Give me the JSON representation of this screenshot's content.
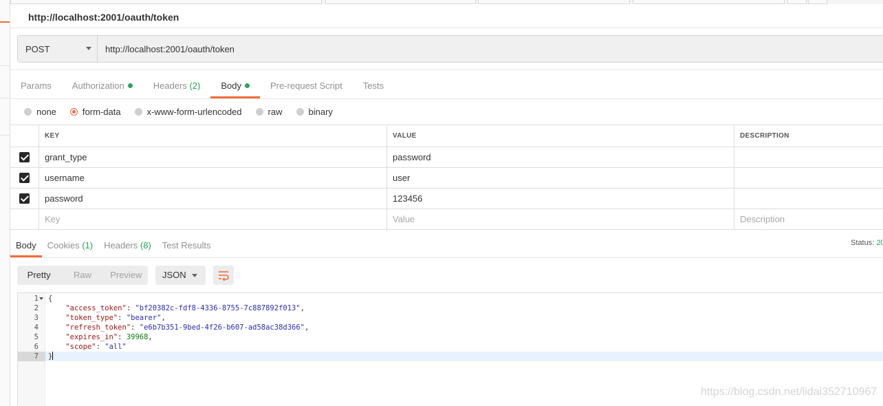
{
  "request": {
    "title": "http://localhost:2001/oauth/token",
    "method": "POST",
    "url": "http://localhost:2001/oauth/token"
  },
  "request_tabs": [
    {
      "label": "Params"
    },
    {
      "label": "Authorization",
      "dot": true
    },
    {
      "label": "Headers",
      "count": "(2)"
    },
    {
      "label": "Body",
      "dot": true,
      "active": true
    },
    {
      "label": "Pre-request Script"
    },
    {
      "label": "Tests"
    }
  ],
  "body_types": [
    {
      "label": "none",
      "selected": false
    },
    {
      "label": "form-data",
      "selected": true
    },
    {
      "label": "x-www-form-urlencoded",
      "selected": false
    },
    {
      "label": "raw",
      "selected": false
    },
    {
      "label": "binary",
      "selected": false
    }
  ],
  "params_table": {
    "headers": [
      "KEY",
      "VALUE",
      "DESCRIPTION"
    ],
    "rows": [
      {
        "checked": true,
        "key": "grant_type",
        "value": "password",
        "description": ""
      },
      {
        "checked": true,
        "key": "username",
        "value": "user",
        "description": ""
      },
      {
        "checked": true,
        "key": "password",
        "value": "123456",
        "description": ""
      }
    ],
    "placeholder": {
      "key": "Key",
      "value": "Value",
      "description": "Description"
    }
  },
  "response_tabs": [
    {
      "label": "Body",
      "active": true
    },
    {
      "label": "Cookies",
      "count": "(1)"
    },
    {
      "label": "Headers",
      "count": "(8)"
    },
    {
      "label": "Test Results"
    }
  ],
  "status": {
    "label": "Status:",
    "code": "20"
  },
  "view_modes": [
    "Pretty",
    "Raw",
    "Preview"
  ],
  "active_view": "Pretty",
  "format": "JSON",
  "response_lines": [
    {
      "n": "1",
      "text": "{"
    },
    {
      "n": "2",
      "key": "\"access_token\"",
      "value": "\"bf20382c-fdf8-4336-8755-7c887892f013\"",
      "trail": ","
    },
    {
      "n": "3",
      "key": "\"token_type\"",
      "value": "\"bearer\"",
      "trail": ","
    },
    {
      "n": "4",
      "key": "\"refresh_token\"",
      "value": "\"e6b7b351-9bed-4f26-b607-ad58ac38d366\"",
      "trail": ","
    },
    {
      "n": "5",
      "key": "\"expires_in\"",
      "number": "39968",
      "trail": ","
    },
    {
      "n": "6",
      "key": "\"scope\"",
      "value": "\"all\"",
      "trail": ""
    },
    {
      "n": "7",
      "text": "}"
    }
  ],
  "watermark": "https://blog.csdn.net/lidai352710967",
  "colors": {
    "accent": "#f26b3a",
    "success": "#26a65b"
  },
  "icons": {
    "method_dropdown": "chevron-down-icon",
    "wrap": "wrap-lines-icon",
    "check": "checkbox-checked-icon"
  }
}
